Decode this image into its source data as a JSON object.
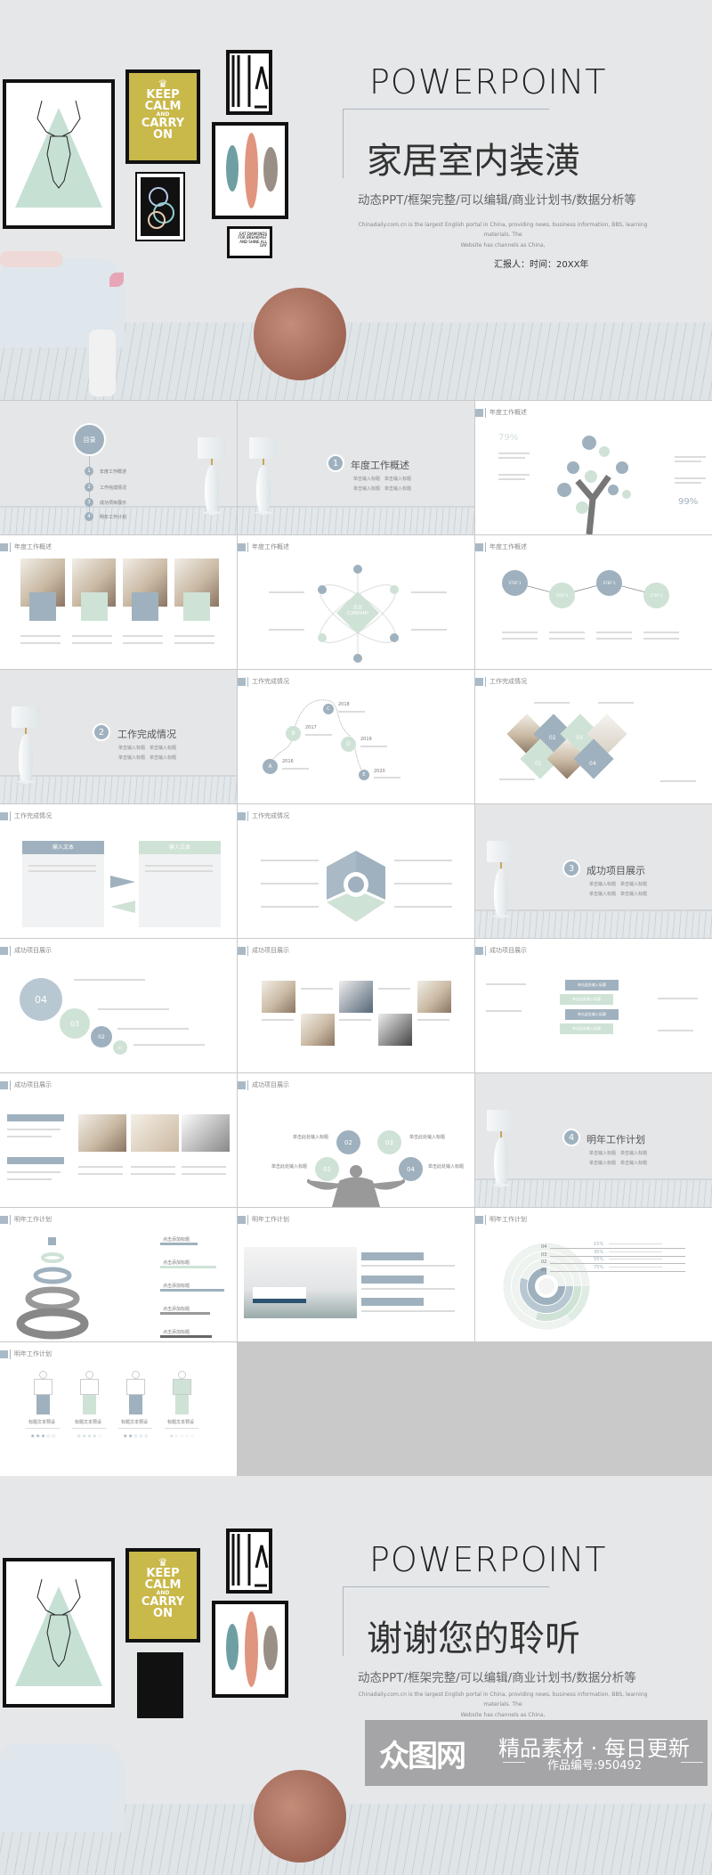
{
  "cover": {
    "title_en": "POWERPOINT",
    "title_cn": "家居室内装潢",
    "subtitle": "动态PPT/框架完整/可以编辑/商业计划书/数据分析等",
    "desc_line1": "Chinadaily.com.cn is the largest English portal in China, providing news, business information, BBS, learning materials. The",
    "desc_line2": "Website has channels as China,",
    "reporter": "汇报人：时间：20XX年",
    "poster": {
      "l1": "KEEP",
      "l2": "CALM",
      "l3": "AND",
      "l4": "CARRY",
      "l5": "ON"
    },
    "small_poster": "EAT DIAMONDS FOR BREAKFAST AND SHINE ALL DAY"
  },
  "toc": {
    "title": "目录",
    "items": [
      {
        "num": "1",
        "label": "年度工作概述"
      },
      {
        "num": "2",
        "label": "工作完成情况"
      },
      {
        "num": "3",
        "label": "成功项目展示"
      },
      {
        "num": "4",
        "label": "明年工作计划"
      }
    ]
  },
  "sections": [
    {
      "num": "1",
      "title": "年度工作概述",
      "subs": [
        "单击输入标题",
        "单击输入标题",
        "单击输入标题",
        "单击输入标题"
      ]
    },
    {
      "num": "2",
      "title": "工作完成情况",
      "subs": [
        "单击输入标题",
        "单击输入标题",
        "单击输入标题",
        "单击输入标题"
      ]
    },
    {
      "num": "3",
      "title": "成功项目展示",
      "subs": [
        "单击输入标题",
        "单击输入标题",
        "单击输入标题",
        "单击输入标题"
      ]
    },
    {
      "num": "4",
      "title": "明年工作计划",
      "subs": [
        "单击输入标题",
        "单击输入标题",
        "单击输入标题",
        "单击输入标题"
      ]
    }
  ],
  "slides": {
    "tree": {
      "header": "年度工作概述",
      "pct_left": "79%",
      "pct_right": "99%"
    },
    "photos": {
      "header": "年度工作概述"
    },
    "company": {
      "header": "年度工作概述",
      "center_cn": "企业",
      "center_en": "COMPANY"
    },
    "steps": {
      "header": "年度工作概述",
      "steps": [
        "STEP 1",
        "STEP 2",
        "STEP 3",
        "STEP 4"
      ]
    },
    "timeline": {
      "header": "工作完成情况",
      "points": [
        {
          "letter": "A",
          "year": "2016"
        },
        {
          "letter": "B",
          "year": "2017"
        },
        {
          "letter": "C",
          "year": "2018"
        },
        {
          "letter": "D",
          "year": "2019"
        },
        {
          "letter": "E",
          "year": "2020"
        }
      ]
    },
    "diamonds": {
      "header": "工作完成情况",
      "nums": [
        "01",
        "02",
        "03",
        "04"
      ]
    },
    "boxes": {
      "header": "工作完成情况",
      "box_label": "输入文本"
    },
    "hexagon": {
      "header": "工作完成情况"
    },
    "circles": {
      "header": "成功项目展示",
      "nums": [
        "04",
        "03",
        "02",
        "01"
      ]
    },
    "gallery": {
      "header": "成功项目展示"
    },
    "arrows": {
      "header": "成功项目展示",
      "label": "单击此处输入标题"
    },
    "cards": {
      "header": "成功项目展示"
    },
    "man": {
      "header": "成功项目展示",
      "label": "单击此处输入标题",
      "nums": [
        "01",
        "02",
        "03",
        "04"
      ]
    },
    "rings": {
      "header": "明年工作计划",
      "label": "点击添加标题"
    },
    "bedroom": {
      "header": "明年工作计划"
    },
    "radial": {
      "header": "明年工作计划",
      "rows": [
        {
          "num": "04",
          "pct": 15,
          "pct_label": "15%"
        },
        {
          "num": "03",
          "pct": 30,
          "pct_label": "30%"
        },
        {
          "num": "02",
          "pct": 55,
          "pct_label": "55%"
        },
        {
          "num": "01",
          "pct": 75,
          "pct_label": "75%"
        }
      ]
    },
    "figures": {
      "header": "明年工作计划",
      "label": "标题文本预设",
      "ratings": [
        3,
        4,
        2,
        1
      ],
      "max_rating": 5
    }
  },
  "ending": {
    "title_en": "POWERPOINT",
    "title_cn": "谢谢您的聆听",
    "subtitle": "动态PPT/框架完整/可以编辑/商业计划书/数据分析等",
    "desc_line1": "Chinadaily.com.cn is the largest English portal in China, providing news, business information, BBS, learning materials. The",
    "desc_line2": "Website has channels as China,"
  },
  "watermark": {
    "logo": "众图网",
    "slogan": "精品素材 · 每日更新",
    "code": "作品编号:950492"
  },
  "colors": {
    "accent_blue": "#9fb1be",
    "accent_mint": "#cfe2d6",
    "wall": "#e6e7e9",
    "poster_yellow": "#c9b84a"
  }
}
